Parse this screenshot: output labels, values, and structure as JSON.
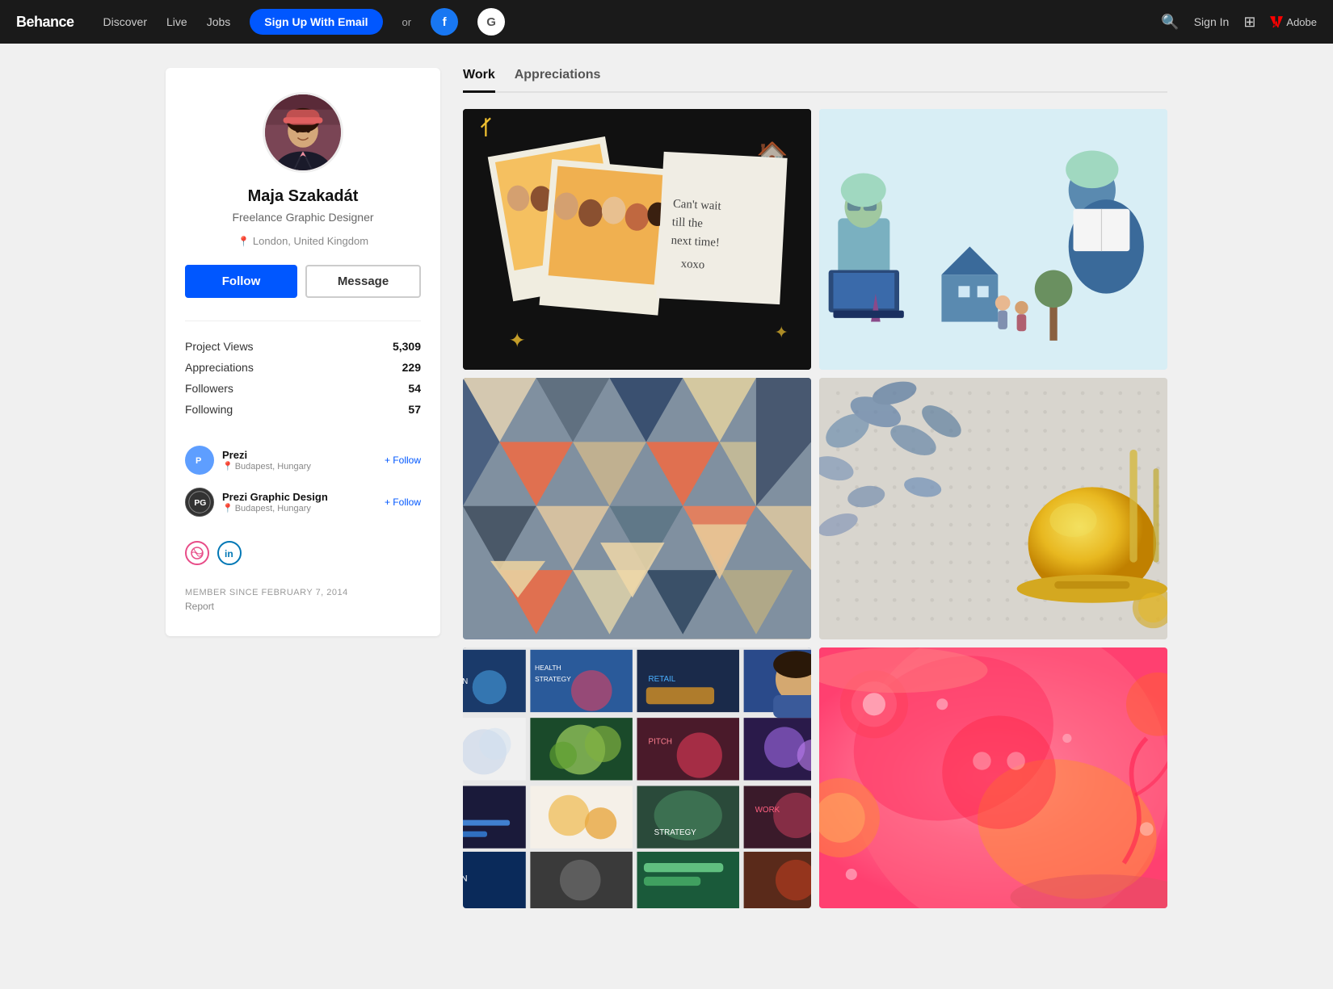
{
  "nav": {
    "logo": "Behance",
    "links": [
      {
        "label": "Discover",
        "id": "discover"
      },
      {
        "label": "Live",
        "id": "live"
      },
      {
        "label": "Jobs",
        "id": "jobs"
      }
    ],
    "signup_btn": "Sign Up With Email",
    "or_text": "or",
    "signin_text": "Sign In",
    "adobe_text": "Adobe"
  },
  "profile": {
    "name": "Maja Szakadát",
    "title": "Freelance Graphic Designer",
    "location": "London, United Kingdom",
    "follow_btn": "Follow",
    "message_btn": "Message",
    "stats": [
      {
        "label": "Project Views",
        "value": "5,309"
      },
      {
        "label": "Appreciations",
        "value": "229"
      },
      {
        "label": "Followers",
        "value": "54"
      },
      {
        "label": "Following",
        "value": "57"
      }
    ],
    "follows": [
      {
        "name": "Prezi",
        "location": "Budapest, Hungary",
        "logo": "P",
        "logo_class": "follow-logo-prezi"
      },
      {
        "name": "Prezi Graphic Design",
        "location": "Budapest, Hungary",
        "logo": "P",
        "logo_class": "follow-logo-prezi2"
      }
    ],
    "follow_action": "+ Follow",
    "member_since": "MEMBER SINCE FEBRUARY 7, 2014",
    "report": "Report"
  },
  "tabs": [
    {
      "label": "Work",
      "id": "work",
      "active": true
    },
    {
      "label": "Appreciations",
      "id": "appreciations",
      "active": false
    }
  ]
}
